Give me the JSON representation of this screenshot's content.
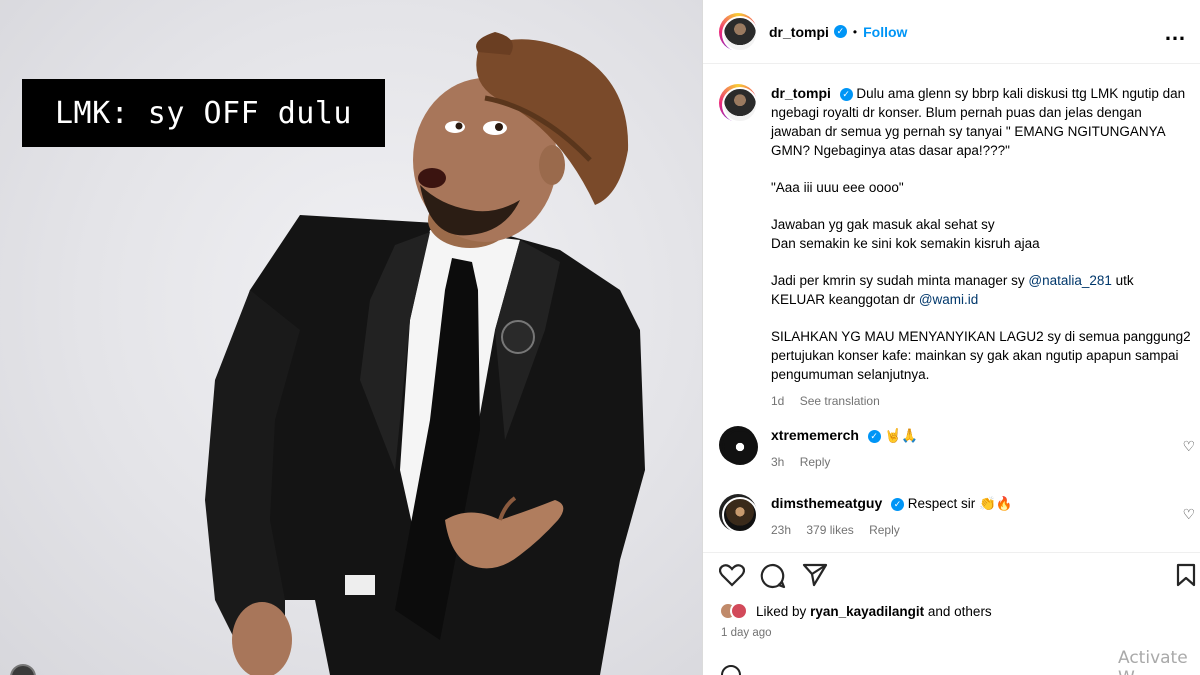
{
  "photo": {
    "caption": "LMK: sy OFF dulu"
  },
  "header": {
    "username": "dr_tompi",
    "verified": "✓",
    "separator": "•",
    "follow_label": "Follow",
    "more_icon": "more-options-icon"
  },
  "post": {
    "username": "dr_tompi",
    "paragraph1": "Dulu ama glenn sy bbrp kali diskusi ttg LMK ngutip dan ngebagi royalti dr konser. Blum pernah puas dan jelas dengan jawaban dr semua yg pernah sy tanyai \" EMANG NGITUNGANYA GMN? Ngebaginya atas dasar apa!???\"",
    "paragraph2": "\"Aaa iii uuu eee oooo\"",
    "paragraph3a": "Jawaban yg gak masuk akal sehat sy",
    "paragraph3b": "Dan semakin ke sini kok semakin kisruh ajaa",
    "paragraph4_pre": "Jadi per kmrin sy sudah minta manager sy ",
    "mention1": "@natalia_281",
    "paragraph4_mid": " utk KELUAR keanggotan dr ",
    "mention2": "@wami.id",
    "paragraph5": "SILAHKAN YG MAU MENYANYIKAN LAGU2 sy di semua panggung2 pertujukan konser kafe: mainkan sy gak akan ngutip apapun sampai pengumuman selanjutnya.",
    "time": "1d",
    "translate": "See translation"
  },
  "comments": [
    {
      "username": "xtrememerch",
      "text": "🤘🙏",
      "time": "3h",
      "reply": "Reply"
    },
    {
      "username": "dimsthemeatguy",
      "text": "Respect sir 👏🔥",
      "time": "23h",
      "likes": "379 likes",
      "reply": "Reply"
    }
  ],
  "footer": {
    "liked_by_prefix": "Liked by ",
    "liked_by_user": "ryan_kayadilangit",
    "liked_by_suffix": " and others",
    "time_ago": "1 day ago"
  },
  "overlay": {
    "activate": "Activate W"
  },
  "colors": {
    "accent": "#0095f6",
    "mention": "#00376b",
    "muted": "#737373"
  }
}
